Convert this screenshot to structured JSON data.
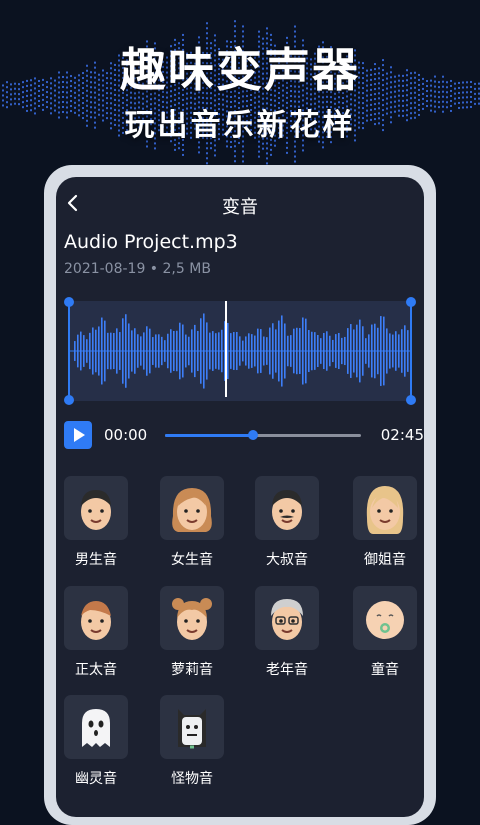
{
  "hero": {
    "title": "趣味变声器",
    "subtitle": "玩出音乐新花样"
  },
  "header": {
    "title": "变音",
    "back_icon": "chevron-left-icon"
  },
  "file": {
    "name": "Audio Project.mp3",
    "meta": "2021-08-19 • 2,5 MB"
  },
  "player": {
    "current_time": "00:00",
    "total_time": "02:45",
    "progress": 0.45,
    "playhead_fraction": 0.46
  },
  "colors": {
    "accent": "#2f7bf5",
    "background": "#0b1220",
    "panel": "#1c2130",
    "tile": "#2c3242"
  },
  "effects": [
    {
      "label": "男生音",
      "icon": "man-avatar-icon"
    },
    {
      "label": "女生音",
      "icon": "woman-avatar-icon"
    },
    {
      "label": "大叔音",
      "icon": "uncle-avatar-icon"
    },
    {
      "label": "御姐音",
      "icon": "lady-avatar-icon"
    },
    {
      "label": "正太音",
      "icon": "boy-avatar-icon"
    },
    {
      "label": "萝莉音",
      "icon": "girl-avatar-icon"
    },
    {
      "label": "老年音",
      "icon": "elder-avatar-icon"
    },
    {
      "label": "童音",
      "icon": "baby-avatar-icon"
    },
    {
      "label": "幽灵音",
      "icon": "ghost-icon"
    },
    {
      "label": "怪物音",
      "icon": "monster-icon"
    }
  ]
}
